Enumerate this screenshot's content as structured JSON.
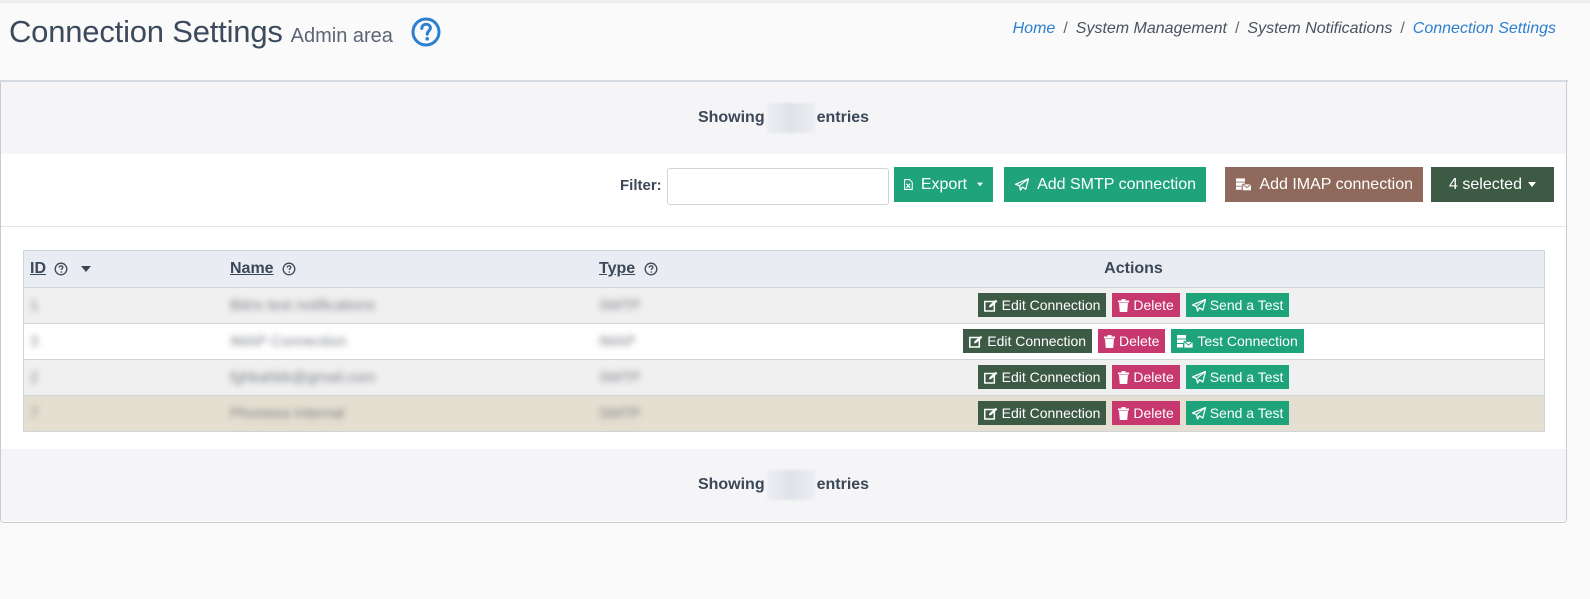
{
  "header": {
    "title": "Connection Settings",
    "subtitle": "Admin area"
  },
  "breadcrumb": [
    "Home",
    "System Management",
    "System Notifications",
    "Connection Settings"
  ],
  "info": {
    "prefix": "Showing",
    "suffix": "entries"
  },
  "toolbar": {
    "filter_label": "Filter:",
    "filter_value": "",
    "export_label": "Export",
    "add_smtp_label": "Add SMTP connection",
    "add_imap_label": "Add IMAP connection",
    "selected_label": "4 selected"
  },
  "table": {
    "columns": [
      "ID",
      "Name",
      "Type",
      "Actions"
    ],
    "sort": {
      "column": "ID",
      "direction": "desc"
    },
    "rows": [
      {
        "id": "1",
        "name": "Bitrix test notifications",
        "type": "SMTP",
        "actions": [
          "Edit Connection",
          "Delete",
          "Send a Test"
        ]
      },
      {
        "id": "3",
        "name": "IMAP Connection",
        "type": "IMAP",
        "actions": [
          "Edit Connection",
          "Delete",
          "Test Connection"
        ]
      },
      {
        "id": "2",
        "name": "fghkahbb@gmail.com",
        "type": "SMTP",
        "actions": [
          "Edit Connection",
          "Delete",
          "Send a Test"
        ]
      },
      {
        "id": "7",
        "name": "Phoneea Internal",
        "type": "SMTP",
        "actions": [
          "Edit Connection",
          "Delete",
          "Send a Test"
        ]
      }
    ]
  },
  "colors": {
    "link": "#2d7fcf",
    "export": "#1fa37a",
    "add_smtp": "#1fa37a",
    "add_imap": "#8f6a5c",
    "selected": "#3d5a45",
    "edit": "#3d5a45",
    "delete": "#c6386e",
    "send": "#1fa37a"
  },
  "icons": {
    "help": "question-circle-icon",
    "export": "file-excel-icon",
    "send": "paper-plane-icon",
    "imap": "server-mail-icon",
    "edit": "edit-icon",
    "delete": "trash-icon",
    "sort": "caret-down-icon"
  }
}
